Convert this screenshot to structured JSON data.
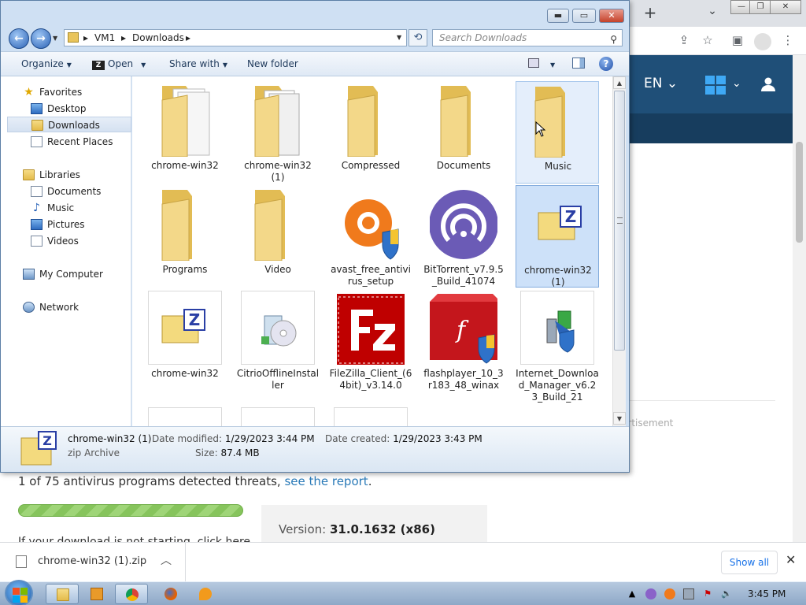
{
  "browser": {
    "new_tab": "+",
    "lang": "EN",
    "ad_text": "ertisement",
    "scan_prefix": "1 of 75 antivirus programs detected threats, ",
    "scan_link": "see the report",
    "scan_suffix": ".",
    "version_label": "Version: ",
    "version_value": "31.0.1632 (x86)",
    "cut_text": "If your download is not starting, click here."
  },
  "download_bar": {
    "file": "chrome-win32 (1).zip",
    "show_all": "Show all"
  },
  "explorer": {
    "breadcrumb": [
      "VM1",
      "Downloads"
    ],
    "search_placeholder": "Search Downloads",
    "commands": {
      "organize": "Organize",
      "open": "Open",
      "share_with": "Share with",
      "new_folder": "New folder"
    },
    "nav": {
      "favorites": "Favorites",
      "desktop": "Desktop",
      "downloads": "Downloads",
      "recent_places": "Recent Places",
      "libraries": "Libraries",
      "documents": "Documents",
      "music": "Music",
      "pictures": "Pictures",
      "videos": "Videos",
      "my_computer": "My Computer",
      "network": "Network"
    },
    "items": [
      {
        "label": "chrome-win32"
      },
      {
        "label": "chrome-win32 (1)"
      },
      {
        "label": "Compressed"
      },
      {
        "label": "Documents"
      },
      {
        "label": "Music"
      },
      {
        "label": "Programs"
      },
      {
        "label": "Video"
      },
      {
        "label": "avast_free_antivirus_setup"
      },
      {
        "label": "BitTorrent_v7.9.5_Build_41074"
      },
      {
        "label": "chrome-win32 (1)"
      },
      {
        "label": "chrome-win32"
      },
      {
        "label": "CitrioOfflineInstaller"
      },
      {
        "label": "FileZilla_Client_(64bit)_v3.14.0"
      },
      {
        "label": "flashplayer_10_3r183_48_winax"
      },
      {
        "label": "Internet_Download_Manager_v6.23_Build_21"
      }
    ],
    "details": {
      "name": "chrome-win32 (1)",
      "type": "zip Archive",
      "modified_label": "Date modified:",
      "modified": "1/29/2023 3:44 PM",
      "created_label": "Date created:",
      "created": "1/29/2023 3:43 PM",
      "size_label": "Size:",
      "size": "87.4 MB"
    }
  },
  "taskbar": {
    "clock": "3:45 PM"
  },
  "colors": {
    "site_header": "#1f4f78",
    "link": "#2a7ab8",
    "explorer_frame": "#cfe0f3"
  }
}
